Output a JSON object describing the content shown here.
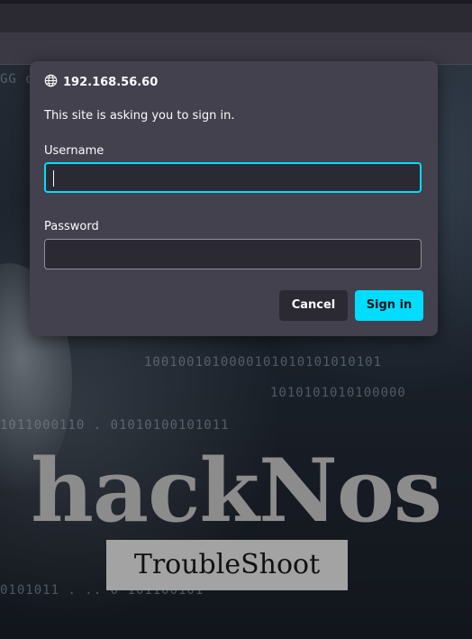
{
  "dialog": {
    "host": "192.168.56.60",
    "message": "This site is asking you to sign in.",
    "username_label": "Username",
    "username_value": "",
    "password_label": "Password",
    "password_value": "",
    "cancel_label": "Cancel",
    "signin_label": "Sign in",
    "accent_color": "#00ddff"
  },
  "background": {
    "logo_text": "hackNos",
    "subtitle": "TroubleShoot"
  }
}
